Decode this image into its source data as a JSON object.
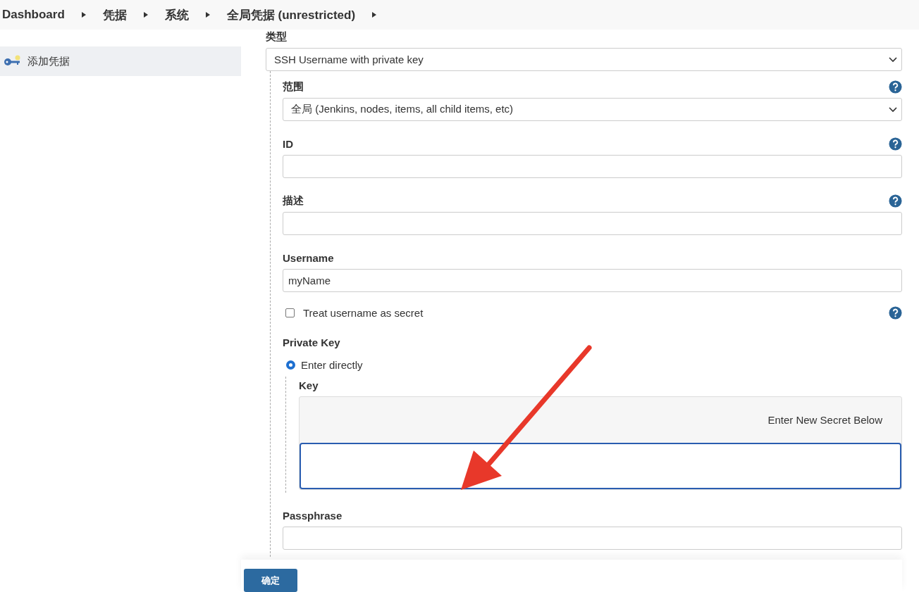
{
  "breadcrumb": [
    {
      "label": "Dashboard"
    },
    {
      "label": "凭据"
    },
    {
      "label": "系统"
    },
    {
      "label": "全局凭据 (unrestricted)"
    }
  ],
  "sidebar": {
    "items": [
      {
        "label": "添加凭据",
        "selected": true
      }
    ]
  },
  "form": {
    "type": {
      "label": "类型",
      "value": "SSH Username with private key"
    },
    "fields": [
      {
        "kind": "select",
        "label": "范围",
        "value": "全局 (Jenkins, nodes, items, all child items, etc)",
        "help": true
      },
      {
        "kind": "text",
        "label": "ID",
        "help": true
      },
      {
        "kind": "text",
        "label": "描述",
        "help": true
      },
      {
        "kind": "text",
        "label": "Username",
        "value": "myName",
        "help": false
      },
      {
        "kind": "checkbox",
        "label": "Treat username as secret",
        "checked": false,
        "help": true
      },
      {
        "kind": "private_key",
        "label": "Private Key",
        "option": {
          "label": "Enter directly",
          "selected": true
        },
        "key": {
          "label": "Key",
          "notice": "Enter New Secret Below"
        }
      },
      {
        "kind": "text",
        "label": "Passphrase",
        "help": false
      }
    ],
    "submit": "确定"
  }
}
